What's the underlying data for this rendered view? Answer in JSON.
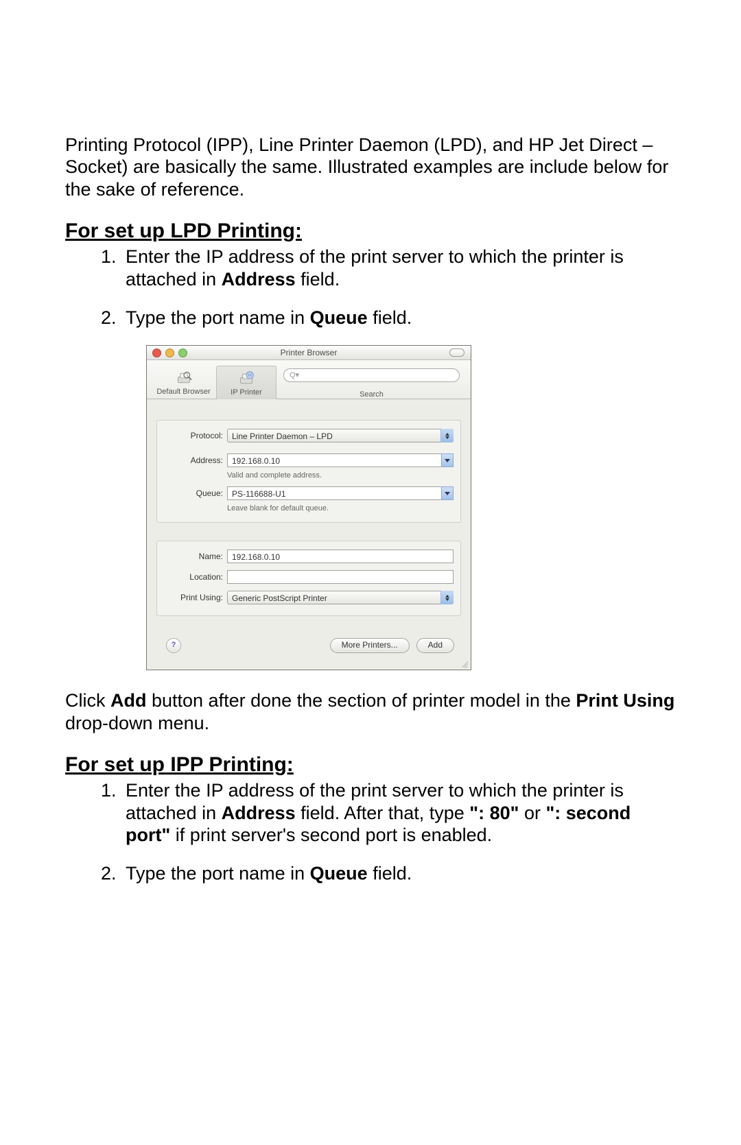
{
  "intro": "Printing Protocol (IPP), Line Printer Daemon (LPD), and HP Jet Direct – Socket) are basically the same. Illustrated examples are include below for the sake of reference.",
  "section_lpd": {
    "heading": "For set up LPD Printing:",
    "step1_pre": "Enter the IP address of the print server to which the printer is attached in ",
    "step1_bold": "Address",
    "step1_post": " field.",
    "step2_pre": "Type the port name in ",
    "step2_bold": "Queue",
    "step2_post": " field."
  },
  "window": {
    "title": "Printer Browser",
    "tabs": {
      "default": "Default Browser",
      "ip": "IP Printer"
    },
    "search_placeholder": "Q▾",
    "search_label": "Search",
    "labels": {
      "protocol": "Protocol:",
      "address": "Address:",
      "queue": "Queue:",
      "name": "Name:",
      "location": "Location:",
      "print_using": "Print Using:"
    },
    "values": {
      "protocol": "Line Printer Daemon – LPD",
      "address": "192.168.0.10",
      "address_hint": "Valid and complete address.",
      "queue": "PS-116688-U1",
      "queue_hint": "Leave blank for default queue.",
      "name": "192.168.0.10",
      "location": "",
      "print_using": "Generic PostScript Printer"
    },
    "buttons": {
      "more": "More Printers...",
      "add": "Add"
    },
    "help": "?"
  },
  "after_window": {
    "pre": "Click ",
    "b1": "Add",
    "mid": " button after done the section of printer model in the ",
    "b2": "Print Using",
    "post": " drop-down menu."
  },
  "section_ipp": {
    "heading": "For set up IPP Printing:",
    "s1_a": "Enter the IP address of the print server to which the printer is attached in ",
    "s1_b": "Address",
    "s1_c": " field. After that, type ",
    "s1_d": "\": 80\"",
    "s1_e": " or ",
    "s1_f": "\": second port\"",
    "s1_g": " if print server's second port is enabled.",
    "s2_a": "Type the port name in ",
    "s2_b": "Queue",
    "s2_c": " field."
  }
}
